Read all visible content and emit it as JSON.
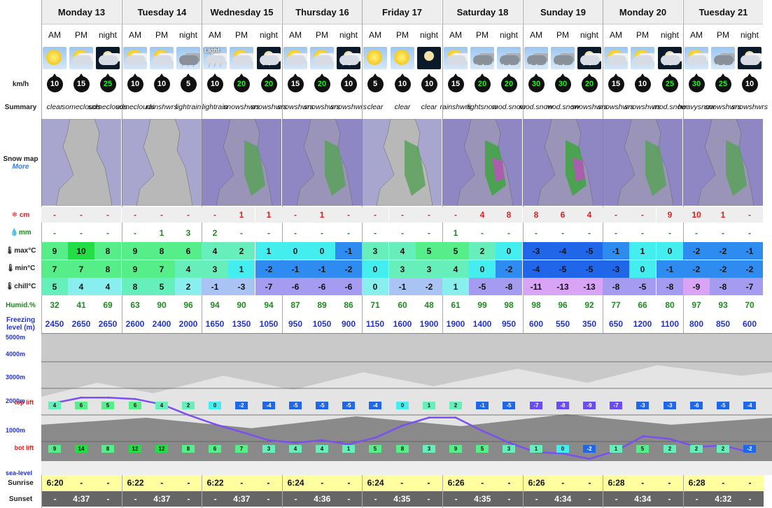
{
  "days": [
    "Monday 13",
    "Tuesday 14",
    "Wednesday 15",
    "Thursday 16",
    "Friday 17",
    "Saturday 18",
    "Sunday 19",
    "Monday 20",
    "Tuesday 21"
  ],
  "periods": [
    "AM",
    "PM",
    "night"
  ],
  "labels": {
    "wind": "km/h",
    "summary": "Summary",
    "snowmap": "Snow map",
    "more": "More",
    "snow": "cm",
    "rain": "mm",
    "max": "max°C",
    "min": "min°C",
    "chill": "chill°C",
    "humid": "Humid.%",
    "freezing": "Freezing level (m)",
    "alt_5000": "5000m",
    "alt_4000": "4000m",
    "alt_3000": "3000m",
    "alt_2000": "2000m",
    "alt_1000": "1000m",
    "top_lift": "top lift",
    "bot_lift": "bot lift",
    "sea_level": "sea-level",
    "sunrise": "Sunrise",
    "sunset": "Sunset"
  },
  "weather_icons": [
    "sun-icon",
    "sun-cloud-icon",
    "moon-cloud-icon",
    "sun-cloud-icon",
    "sun-cloud-icon",
    "dark-cloud-rain-icon",
    "light-rain-icon",
    "sun-cloud-icon",
    "night-snow-icon",
    "sun-cloud-icon",
    "sun-cloud-icon",
    "night-snow-icon",
    "sun-icon",
    "sun-icon",
    "moon-icon",
    "sun-cloud-icon",
    "snow-cloud-icon",
    "snow-cloud-icon",
    "snow-cloud-icon",
    "snow-cloud-icon",
    "night-snow-icon",
    "sun-cloud-icon",
    "sun-cloud-icon",
    "night-snow-icon",
    "sun-cloud-icon",
    "snow-cloud-icon",
    "moon-cloud-icon"
  ],
  "light_label": "Light",
  "wind": [
    10,
    15,
    25,
    10,
    10,
    5,
    10,
    20,
    20,
    15,
    20,
    10,
    5,
    10,
    10,
    15,
    20,
    20,
    30,
    30,
    20,
    15,
    10,
    25,
    30,
    25,
    10
  ],
  "wind_green": [
    false,
    false,
    true,
    false,
    false,
    false,
    false,
    true,
    true,
    false,
    true,
    false,
    false,
    false,
    false,
    false,
    true,
    true,
    true,
    true,
    true,
    false,
    false,
    true,
    true,
    true,
    false
  ],
  "summary": [
    [
      "clear"
    ],
    [
      "some",
      "clouds"
    ],
    [
      "some",
      "clouds"
    ],
    [
      "some",
      "clouds"
    ],
    [
      "rain",
      "shwrs"
    ],
    [
      "light",
      "rain"
    ],
    [
      "light",
      "rain"
    ],
    [
      "snow",
      "shwrs"
    ],
    [
      "snow",
      "shwrs"
    ],
    [
      "snow",
      "shwrs"
    ],
    [
      "snow",
      "shwrs"
    ],
    [
      "snow",
      "shwrs"
    ],
    [
      "clear"
    ],
    [
      "clear"
    ],
    [
      "clear"
    ],
    [
      "rain",
      "shwrs"
    ],
    [
      "light",
      "snow"
    ],
    [
      "mod.",
      "snow"
    ],
    [
      "mod.",
      "snow"
    ],
    [
      "mod.",
      "snow"
    ],
    [
      "snow",
      "shwrs"
    ],
    [
      "snow",
      "shwrs"
    ],
    [
      "snow",
      "shwrs"
    ],
    [
      "mod.",
      "snow"
    ],
    [
      "heavy",
      "snow"
    ],
    [
      "snow",
      "shwrs"
    ],
    [
      "snow",
      "shwrs"
    ]
  ],
  "snow": [
    "-",
    "-",
    "-",
    "-",
    "-",
    "-",
    "-",
    "1",
    "1",
    "-",
    "1",
    "-",
    "-",
    "-",
    "-",
    "-",
    "4",
    "8",
    "8",
    "6",
    "4",
    "-",
    "-",
    "9",
    "10",
    "1",
    "-"
  ],
  "rain": [
    "-",
    "-",
    "-",
    "-",
    "1",
    "3",
    "2",
    "-",
    "-",
    "-",
    "-",
    "-",
    "-",
    "-",
    "-",
    "1",
    "-",
    "-",
    "-",
    "-",
    "-",
    "-",
    "-",
    "-",
    "-",
    "-",
    "-"
  ],
  "max": [
    9,
    10,
    8,
    9,
    8,
    6,
    4,
    2,
    1,
    0,
    0,
    -1,
    3,
    4,
    5,
    5,
    2,
    0,
    -3,
    -4,
    -5,
    -1,
    1,
    0,
    -2,
    -2,
    -1
  ],
  "min": [
    7,
    7,
    8,
    9,
    7,
    4,
    3,
    1,
    -2,
    -1,
    -1,
    -2,
    0,
    3,
    3,
    4,
    0,
    -2,
    -4,
    -5,
    -5,
    -3,
    0,
    -1,
    -2,
    -2,
    -2
  ],
  "chill": [
    5,
    4,
    4,
    8,
    5,
    2,
    -1,
    -3,
    -7,
    -6,
    -6,
    -6,
    0,
    -1,
    -2,
    1,
    -5,
    -8,
    -11,
    -13,
    -13,
    -8,
    -5,
    -8,
    -9,
    -8,
    -7
  ],
  "humid": [
    32,
    41,
    69,
    63,
    90,
    96,
    94,
    90,
    94,
    87,
    89,
    86,
    71,
    60,
    48,
    61,
    99,
    98,
    98,
    96,
    92,
    77,
    66,
    80,
    97,
    93,
    70
  ],
  "freezing": [
    2450,
    2650,
    2650,
    2600,
    2400,
    2000,
    1650,
    1350,
    1050,
    950,
    1050,
    900,
    1150,
    1600,
    1900,
    1900,
    1400,
    950,
    600,
    550,
    350,
    650,
    1200,
    1100,
    800,
    850,
    600
  ],
  "top_lift": [
    4,
    6,
    5,
    6,
    4,
    2,
    0,
    -2,
    -4,
    -5,
    -5,
    -5,
    -4,
    0,
    1,
    2,
    -1,
    -5,
    -7,
    -8,
    -9,
    -7,
    -3,
    -3,
    -6,
    -5,
    -4
  ],
  "bot_lift": [
    9,
    14,
    8,
    12,
    12,
    8,
    6,
    7,
    3,
    4,
    4,
    1,
    5,
    8,
    3,
    9,
    5,
    3,
    1,
    0,
    -2,
    1,
    5,
    2,
    2,
    2,
    -2
  ],
  "sunrise": [
    "6:20",
    "6:22",
    "6:22",
    "6:24",
    "6:24",
    "6:26",
    "6:26",
    "6:28",
    "6:28"
  ],
  "sunset": [
    "4:37",
    "4:37",
    "4:37",
    "4:36",
    "4:35",
    "4:35",
    "4:34",
    "4:34",
    "4:32"
  ],
  "dash": "-"
}
